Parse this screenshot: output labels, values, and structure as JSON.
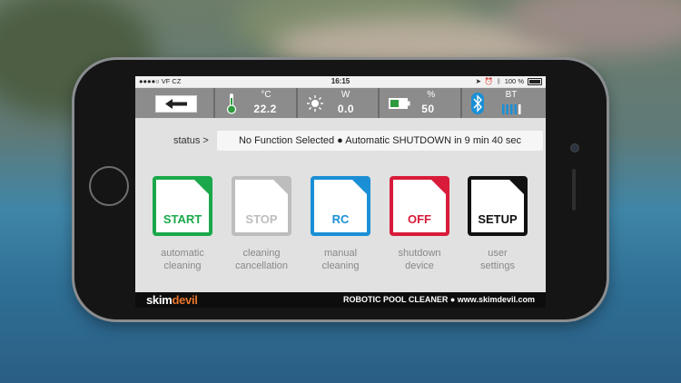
{
  "status_bar": {
    "carrier": "●●●●○ VF CZ",
    "time": "16:15",
    "battery": "100 %"
  },
  "toolbar": {
    "temp_unit": "°C",
    "temp_value": "22.2",
    "watt_unit": "W",
    "watt_value": "0.0",
    "battery_unit": "%",
    "battery_value": "50",
    "bt_label": "BT"
  },
  "status": {
    "label": "status >",
    "message": "No Function Selected ● Automatic SHUTDOWN in 9 min 40 sec"
  },
  "buttons": [
    {
      "label": "START",
      "caption1": "automatic",
      "caption2": "cleaning",
      "color": "#1aa84a"
    },
    {
      "label": "STOP",
      "caption1": "cleaning",
      "caption2": "cancellation",
      "color": "#bdbdbd"
    },
    {
      "label": "RC",
      "caption1": "manual",
      "caption2": "cleaning",
      "color": "#1a8fd6"
    },
    {
      "label": "OFF",
      "caption1": "shutdown",
      "caption2": "device",
      "color": "#d81b3a"
    },
    {
      "label": "SETUP",
      "caption1": "user",
      "caption2": "settings",
      "color": "#111111"
    }
  ],
  "footer": {
    "brand_skim": "skim",
    "brand_devil": "devil",
    "tagline": "ROBOTIC POOL CLEANER ● www.skimdevil.com"
  }
}
